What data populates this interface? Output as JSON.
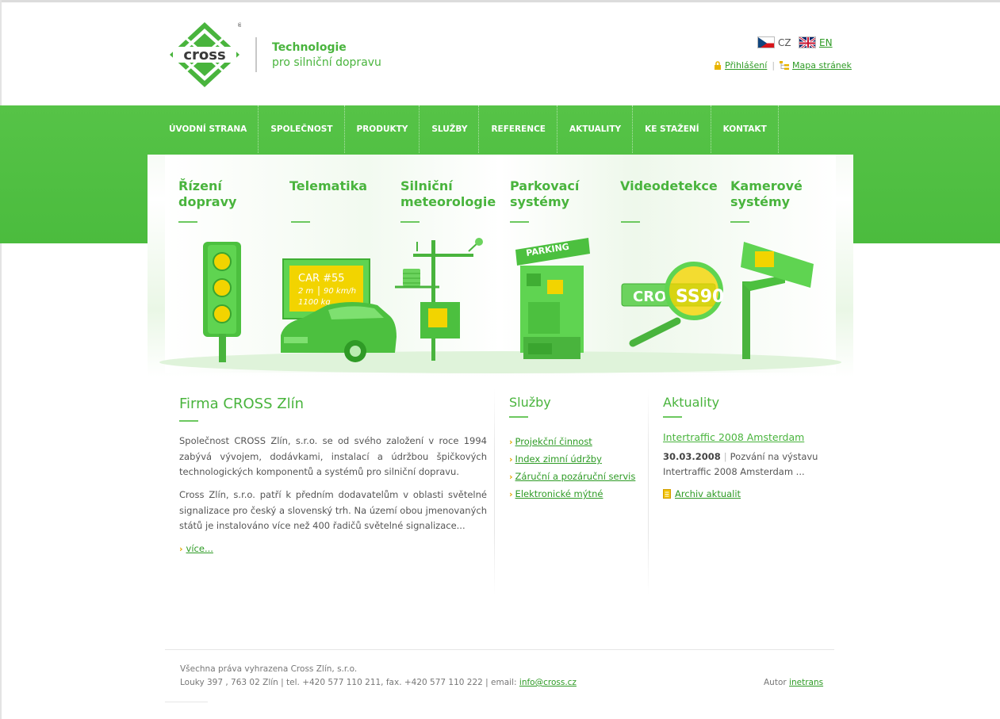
{
  "header": {
    "logo_text": "cross",
    "tagline_1": "Technologie",
    "tagline_2": "pro silniční dopravu",
    "lang_cz": "CZ",
    "lang_en": "EN",
    "login": "Přihlášení",
    "sitemap": "Mapa stránek"
  },
  "nav": [
    "ÚVODNÍ STRANA",
    "SPOLEČNOST",
    "PRODUKTY",
    "SLUŽBY",
    "REFERENCE",
    "AKTUALITY",
    "KE STAŽENÍ",
    "KONTAKT"
  ],
  "hero": {
    "categories": [
      {
        "l1": "Řízení",
        "l2": "dopravy"
      },
      {
        "l1": "Telematika",
        "l2": ""
      },
      {
        "l1": "Silniční",
        "l2": "meteorologie"
      },
      {
        "l1": "Parkovací",
        "l2": "systémy"
      },
      {
        "l1": "Videodetekce",
        "l2": ""
      },
      {
        "l1": "Kamerové",
        "l2": "systémy"
      }
    ],
    "telematics_sign": {
      "car": "CAR #55",
      "distance": "2 m",
      "speed": "90 km/h",
      "weight": "1100 kg"
    },
    "parking_label": "PARKING",
    "plate_left": "CRO",
    "plate_magnified": "SS90"
  },
  "firma": {
    "title": "Firma CROSS Zlín",
    "p1": "Společnost CROSS Zlín, s.r.o. se od svého založení v roce 1994 zabývá vývojem, dodávkami, instalací a údržbou špičkových technologických komponentů a systémů pro silniční dopravu.",
    "p2": "Cross Zlín, s.r.o. patří k předním dodavatelům v oblasti světelné signalizace pro český a slovenský trh. Na území obou jmenovaných států je instalováno více než 400 řadičů světelné signalizace...",
    "more": "více..."
  },
  "sluzby": {
    "title": "Služby",
    "items": [
      "Projekční činnost",
      "Index zimní údržby",
      "Záruční a pozáruční servis",
      "Elektronické mýtné"
    ]
  },
  "aktuality": {
    "title": "Aktuality",
    "headline": "Intertraffic 2008 Amsterdam",
    "date": "30.03.2008",
    "teaser": "Pozvání na výstavu Intertraffic 2008 Amsterdam ...",
    "archive": "Archiv aktualit"
  },
  "footer": {
    "rights": "Všechna práva vyhrazena Cross Zlín, s.r.o.",
    "address": "Louky 397 , 763 02 Zlín | tel. +420 577 110 211, fax. +420 577 110 222 | email:",
    "email": "info@cross.cz",
    "author_label": "Autor",
    "author": "inetrans"
  },
  "colors": {
    "brand_green": "#49b43d",
    "band_green": "#52c044",
    "link_green": "#2e9b25",
    "accent_yellow": "#f2d400"
  }
}
